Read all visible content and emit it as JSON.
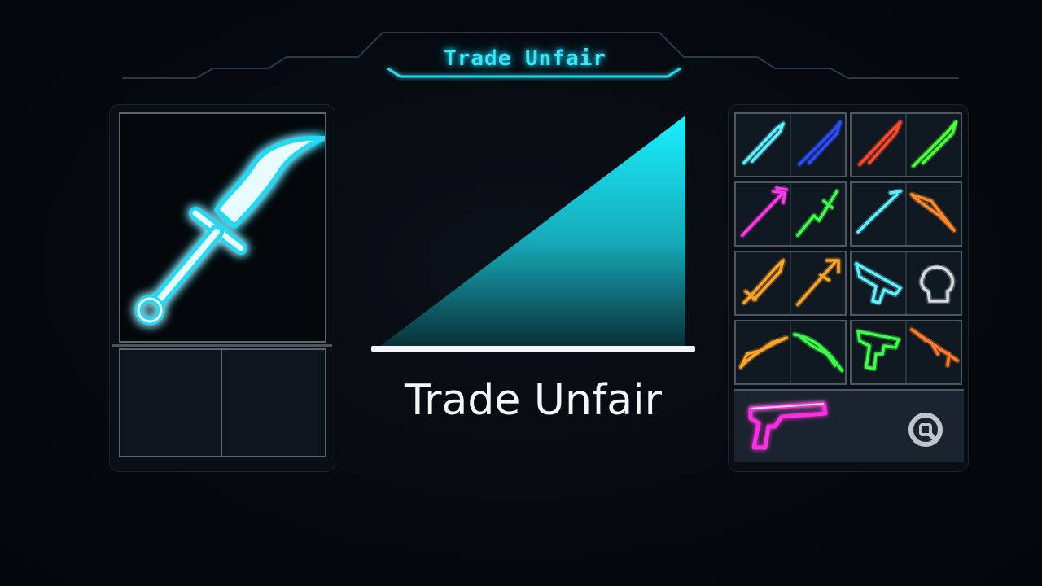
{
  "header": {
    "title": "Trade Unfair"
  },
  "trade": {
    "status_label": "Trade Unfair",
    "fairness_meter": 1.0
  },
  "offer": {
    "main_item_icon": "cyan-neon-sword-icon",
    "slots": [
      "empty-slot",
      "empty-slot"
    ]
  },
  "inventory": {
    "cells": [
      {
        "left_icon": "cyan-dagger-icon",
        "right_icon": "blue-dagger-icon"
      },
      {
        "left_icon": "red-dagger-icon",
        "right_icon": "green-dagger-icon"
      },
      {
        "left_icon": "magenta-trident-icon",
        "right_icon": "green-spear-icon"
      },
      {
        "left_icon": "cyan-blade-icon",
        "right_icon": "orange-knife-icon"
      },
      {
        "left_icon": "orange-dagger-icon",
        "right_icon": "orange-spear-icon"
      },
      {
        "left_icon": "cyan-rifle-icon",
        "right_icon": "mystery-fist-icon"
      },
      {
        "left_icon": "orange-bow-icon",
        "right_icon": "green-bow-icon"
      },
      {
        "left_icon": "green-pistol-icon",
        "right_icon": "orange-rifle-icon"
      }
    ],
    "featured_item_icon": "magenta-pistol-icon",
    "action_key": "q-key-icon"
  },
  "colors": {
    "accent": "#3fe6f2",
    "meter_fill": "#19d6e4",
    "panel_border": "#5b6670"
  }
}
